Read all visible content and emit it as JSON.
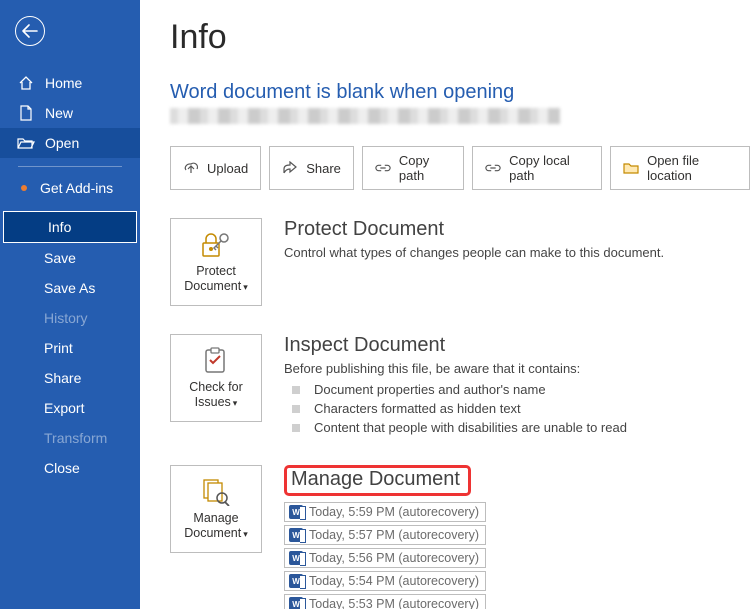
{
  "sidebar": {
    "back": "Back",
    "home": "Home",
    "new": "New",
    "open": "Open",
    "addins": "Get Add-ins",
    "info": "Info",
    "save": "Save",
    "saveas": "Save As",
    "history": "History",
    "print": "Print",
    "share": "Share",
    "export": "Export",
    "transform": "Transform",
    "close": "Close"
  },
  "page": {
    "title": "Info",
    "doc_title": "Word document is blank when opening"
  },
  "actions": {
    "upload": "Upload",
    "share": "Share",
    "copypath": "Copy path",
    "copylocal": "Copy local path",
    "openloc": "Open file location"
  },
  "protect": {
    "btn": "Protect Document",
    "title": "Protect Document",
    "desc": "Control what types of changes people can make to this document."
  },
  "inspect": {
    "btn": "Check for Issues",
    "title": "Inspect Document",
    "desc": "Before publishing this file, be aware that it contains:",
    "items": [
      "Document properties and author's name",
      "Characters formatted as hidden text",
      "Content that people with disabilities are unable to read"
    ]
  },
  "manage": {
    "btn": "Manage Document",
    "title": "Manage Document",
    "versions": [
      "Today, 5:59 PM (autorecovery)",
      "Today, 5:57 PM (autorecovery)",
      "Today, 5:56 PM (autorecovery)",
      "Today, 5:54 PM (autorecovery)",
      "Today, 5:53 PM (autorecovery)"
    ]
  }
}
